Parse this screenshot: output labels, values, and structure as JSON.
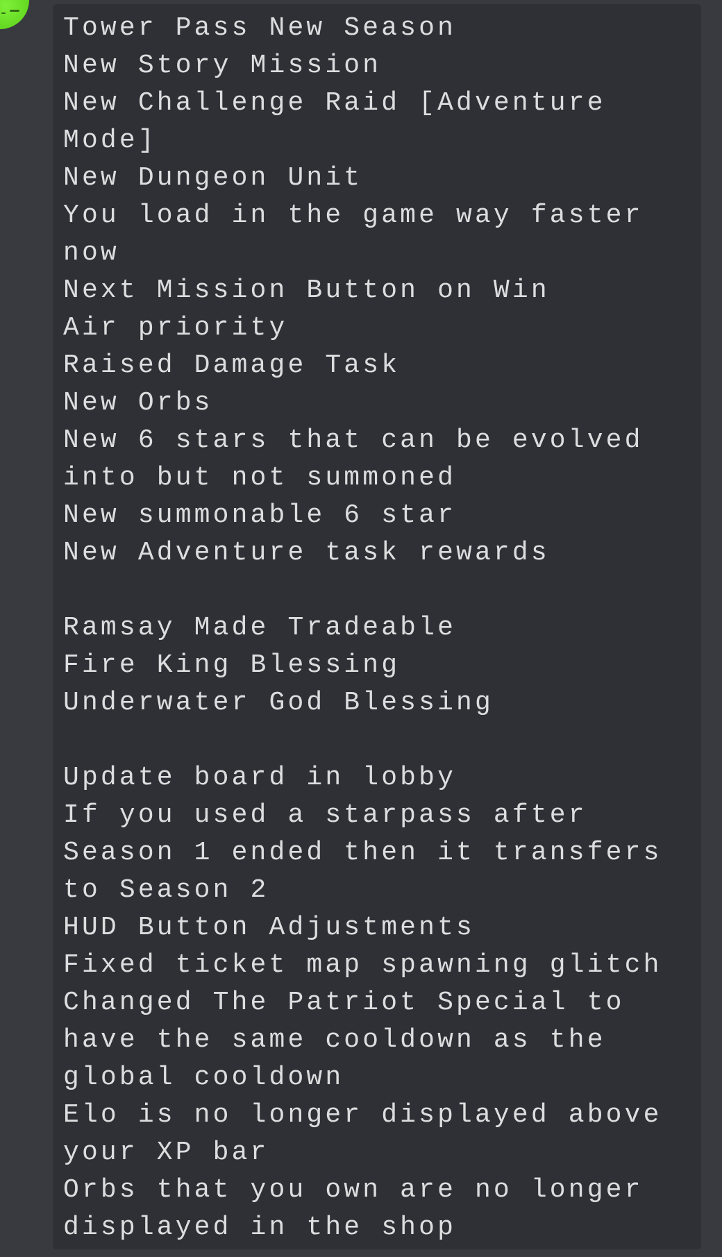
{
  "message": {
    "avatar": {
      "icon": "user-avatar-icon",
      "color": "#6be02a"
    },
    "code_block": {
      "lines": [
        "Tower Pass New Season",
        "New Story Mission",
        "New Challenge Raid [Adventure",
        "Mode]",
        "New Dungeon Unit",
        "You load in the game way faster",
        "now",
        "Next Mission Button on Win",
        "Air priority",
        "Raised Damage Task",
        "New Orbs",
        "New 6 stars that can be evolved",
        "into but not summoned",
        "New summonable 6 star",
        "New Adventure task rewards",
        "",
        "Ramsay Made Tradeable",
        "Fire King Blessing",
        "Underwater God Blessing",
        "",
        "Update board in lobby",
        "If you used a starpass after",
        "Season 1 ended then it transfers",
        "to Season 2",
        "HUD Button Adjustments",
        "Fixed ticket map spawning glitch",
        "Changed The Patriot Special to",
        "have the same cooldown as the",
        "global cooldown",
        "Elo is no longer displayed above",
        "your XP bar",
        "Orbs that you own are no longer",
        "displayed in the shop"
      ]
    },
    "colors": {
      "page_background": "#383a40",
      "code_background": "#2f3035",
      "text": "#dcddde"
    }
  }
}
